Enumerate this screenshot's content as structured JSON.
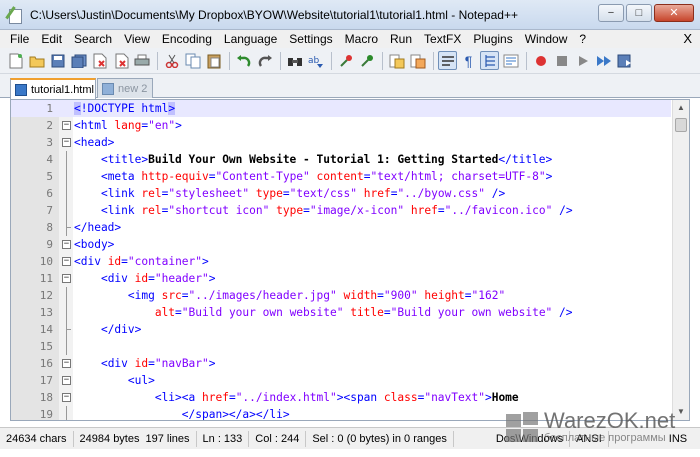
{
  "window": {
    "title": "C:\\Users\\Justin\\Documents\\My Dropbox\\BYOW\\Website\\tutorial1\\tutorial1.html - Notepad++",
    "minimize": "−",
    "maximize": "□",
    "close": "✕"
  },
  "menu": [
    "File",
    "Edit",
    "Search",
    "View",
    "Encoding",
    "Language",
    "Settings",
    "Macro",
    "Run",
    "TextFX",
    "Plugins",
    "Window",
    "?"
  ],
  "menu_close": "X",
  "tabs": [
    {
      "label": "tutorial1.html",
      "active": true
    },
    {
      "label": "new  2",
      "active": false
    }
  ],
  "toolbar_icons": [
    "new-file-icon",
    "open-file-icon",
    "save-icon",
    "save-all-icon",
    "close-icon",
    "close-all-icon",
    "print-icon",
    "cut-icon",
    "copy-icon",
    "paste-icon",
    "undo-icon",
    "redo-icon",
    "find-icon",
    "replace-icon",
    "zoom-in-icon",
    "zoom-out-icon",
    "sync-v-icon",
    "sync-h-icon",
    "word-wrap-icon",
    "show-all-chars-icon",
    "indent-guide-icon",
    "user-lang-icon",
    "record-macro-icon",
    "stop-record-icon",
    "play-macro-icon",
    "play-multiple-icon",
    "save-macro-icon"
  ],
  "code_lines": [
    {
      "n": "1",
      "fold": "",
      "html": "<span class=\"tag hl\">&lt;</span><span class=\"tag\">!DOCTYPE html</span><span class=\"tag hl\">&gt;</span>"
    },
    {
      "n": "2",
      "fold": "box",
      "html": "<span class=\"tag\">&lt;html </span><span class=\"attr\">lang</span><span class=\"tag\">=</span><span class=\"val\">\"en\"</span><span class=\"tag\">&gt;</span>"
    },
    {
      "n": "3",
      "fold": "box",
      "html": "<span class=\"tag\">&lt;head&gt;</span>"
    },
    {
      "n": "4",
      "fold": "line",
      "html": "    <span class=\"tag\">&lt;title&gt;</span><span class=\"txt\">Build Your Own Website - Tutorial 1: Getting Started</span><span class=\"tag\">&lt;/title&gt;</span>"
    },
    {
      "n": "5",
      "fold": "line",
      "html": "    <span class=\"tag\">&lt;meta </span><span class=\"attr\">http-equiv</span><span class=\"tag\">=</span><span class=\"val\">\"Content-Type\"</span> <span class=\"attr\">content</span><span class=\"tag\">=</span><span class=\"val\">\"text/html; charset=UTF-8\"</span><span class=\"tag\">&gt;</span>"
    },
    {
      "n": "6",
      "fold": "line",
      "html": "    <span class=\"tag\">&lt;link </span><span class=\"attr\">rel</span><span class=\"tag\">=</span><span class=\"val\">\"stylesheet\"</span> <span class=\"attr\">type</span><span class=\"tag\">=</span><span class=\"val\">\"text/css\"</span> <span class=\"attr\">href</span><span class=\"tag\">=</span><span class=\"val\">\"../byow.css\"</span> <span class=\"tag\">/&gt;</span>"
    },
    {
      "n": "7",
      "fold": "line",
      "html": "    <span class=\"tag\">&lt;link </span><span class=\"attr\">rel</span><span class=\"tag\">=</span><span class=\"val\">\"shortcut icon\"</span> <span class=\"attr\">type</span><span class=\"tag\">=</span><span class=\"val\">\"image/x-icon\"</span> <span class=\"attr\">href</span><span class=\"tag\">=</span><span class=\"val\">\"../favicon.ico\"</span> <span class=\"tag\">/&gt;</span>"
    },
    {
      "n": "8",
      "fold": "end",
      "html": "<span class=\"tag\">&lt;/head&gt;</span>"
    },
    {
      "n": "9",
      "fold": "box",
      "html": "<span class=\"tag\">&lt;body&gt;</span>"
    },
    {
      "n": "10",
      "fold": "box",
      "html": "<span class=\"tag\">&lt;div </span><span class=\"attr\">id</span><span class=\"tag\">=</span><span class=\"val\">\"container\"</span><span class=\"tag\">&gt;</span>"
    },
    {
      "n": "11",
      "fold": "box",
      "html": "    <span class=\"tag\">&lt;div </span><span class=\"attr\">id</span><span class=\"tag\">=</span><span class=\"val\">\"header\"</span><span class=\"tag\">&gt;</span>"
    },
    {
      "n": "12",
      "fold": "line",
      "html": "        <span class=\"tag\">&lt;img </span><span class=\"attr\">src</span><span class=\"tag\">=</span><span class=\"val\">\"../images/header.jpg\"</span> <span class=\"attr\">width</span><span class=\"tag\">=</span><span class=\"val\">\"900\"</span> <span class=\"attr\">height</span><span class=\"tag\">=</span><span class=\"val\">\"162\"</span>"
    },
    {
      "n": "13",
      "fold": "line",
      "html": "            <span class=\"attr\">alt</span><span class=\"tag\">=</span><span class=\"val\">\"Build your own website\"</span> <span class=\"attr\">title</span><span class=\"tag\">=</span><span class=\"val\">\"Build your own website\"</span> <span class=\"tag\">/&gt;</span>"
    },
    {
      "n": "14",
      "fold": "end",
      "html": "    <span class=\"tag\">&lt;/div&gt;</span>"
    },
    {
      "n": "15",
      "fold": "line",
      "html": ""
    },
    {
      "n": "16",
      "fold": "box",
      "html": "    <span class=\"tag\">&lt;div </span><span class=\"attr\">id</span><span class=\"tag\">=</span><span class=\"val\">\"navBar\"</span><span class=\"tag\">&gt;</span>"
    },
    {
      "n": "17",
      "fold": "box",
      "html": "        <span class=\"tag\">&lt;ul&gt;</span>"
    },
    {
      "n": "18",
      "fold": "box",
      "html": "            <span class=\"tag\">&lt;li&gt;&lt;a </span><span class=\"attr\">href</span><span class=\"tag\">=</span><span class=\"val\">\"../index.html\"</span><span class=\"tag\">&gt;&lt;span </span><span class=\"attr\">class</span><span class=\"tag\">=</span><span class=\"val\">\"navText\"</span><span class=\"tag\">&gt;</span><span class=\"txt\">Home</span>"
    },
    {
      "n": "19",
      "fold": "line",
      "html": "                <span class=\"tag\">&lt;/span&gt;&lt;/a&gt;&lt;/li&gt;</span>"
    }
  ],
  "status": {
    "chars": "24634 chars",
    "bytes": "24984 bytes",
    "lines": "197 lines",
    "ln": "Ln : 133",
    "col": "Col : 244",
    "sel": "Sel : 0 (0 bytes) in 0 ranges",
    "eol": "Dos\\Windows",
    "encoding": "ANSI",
    "mode": "INS"
  },
  "watermark": {
    "name": "WarezOK.net",
    "sub": "бесплатные программы"
  }
}
